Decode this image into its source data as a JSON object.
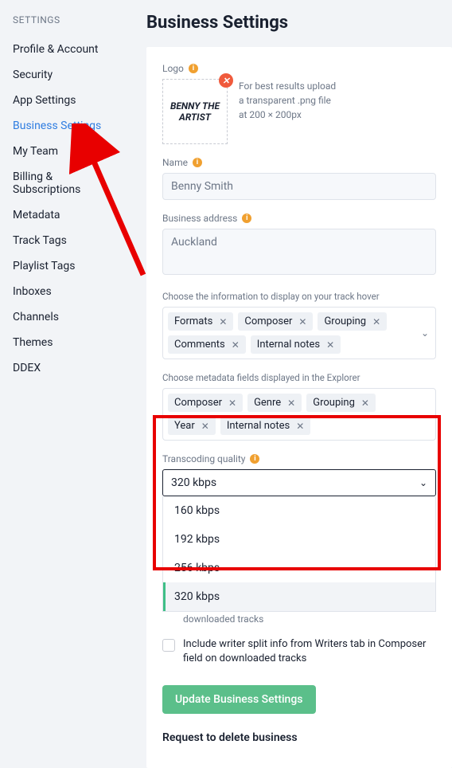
{
  "sidebar": {
    "title": "SETTINGS",
    "items": [
      {
        "label": "Profile & Account",
        "selected": false
      },
      {
        "label": "Security",
        "selected": false
      },
      {
        "label": "App Settings",
        "selected": false
      },
      {
        "label": "Business Settings",
        "selected": true
      },
      {
        "label": "My Team",
        "selected": false
      },
      {
        "label": "Billing & Subscriptions",
        "selected": false
      },
      {
        "label": "Metadata",
        "selected": false
      },
      {
        "label": "Track Tags",
        "selected": false
      },
      {
        "label": "Playlist Tags",
        "selected": false
      },
      {
        "label": "Inboxes",
        "selected": false
      },
      {
        "label": "Channels",
        "selected": false
      },
      {
        "label": "Themes",
        "selected": false
      },
      {
        "label": "DDEX",
        "selected": false
      }
    ]
  },
  "page_title": "Business Settings",
  "logo": {
    "label": "Logo",
    "text": "BENNY THE\nARTIST",
    "hint_l1": "For best results upload",
    "hint_l2": "a transparent .png file",
    "hint_l3": "at 200 × 200px"
  },
  "name": {
    "label": "Name",
    "value": "Benny Smith"
  },
  "address": {
    "label": "Business address",
    "value": "Auckland"
  },
  "hover_info": {
    "label": "Choose the information to display on your track hover",
    "chips": [
      "Formats",
      "Composer",
      "Grouping",
      "Comments",
      "Internal notes"
    ]
  },
  "explorer_fields": {
    "label": "Choose metadata fields displayed in the Explorer",
    "chips": [
      "Composer",
      "Genre",
      "Grouping",
      "Year",
      "Internal notes"
    ]
  },
  "transcoding": {
    "label": "Transcoding quality",
    "selected": "320 kbps",
    "options": [
      "160 kbps",
      "192 kbps",
      "256 kbps",
      "320 kbps"
    ]
  },
  "obscured_tail": "downloaded tracks",
  "writer_split_label": "Include writer split info from Writers tab in Composer field on downloaded tracks",
  "update_button": "Update Business Settings",
  "delete_link": "Request to delete business",
  "glyphs": {
    "x": "✕",
    "chevron": "⌄",
    "info": "i"
  }
}
